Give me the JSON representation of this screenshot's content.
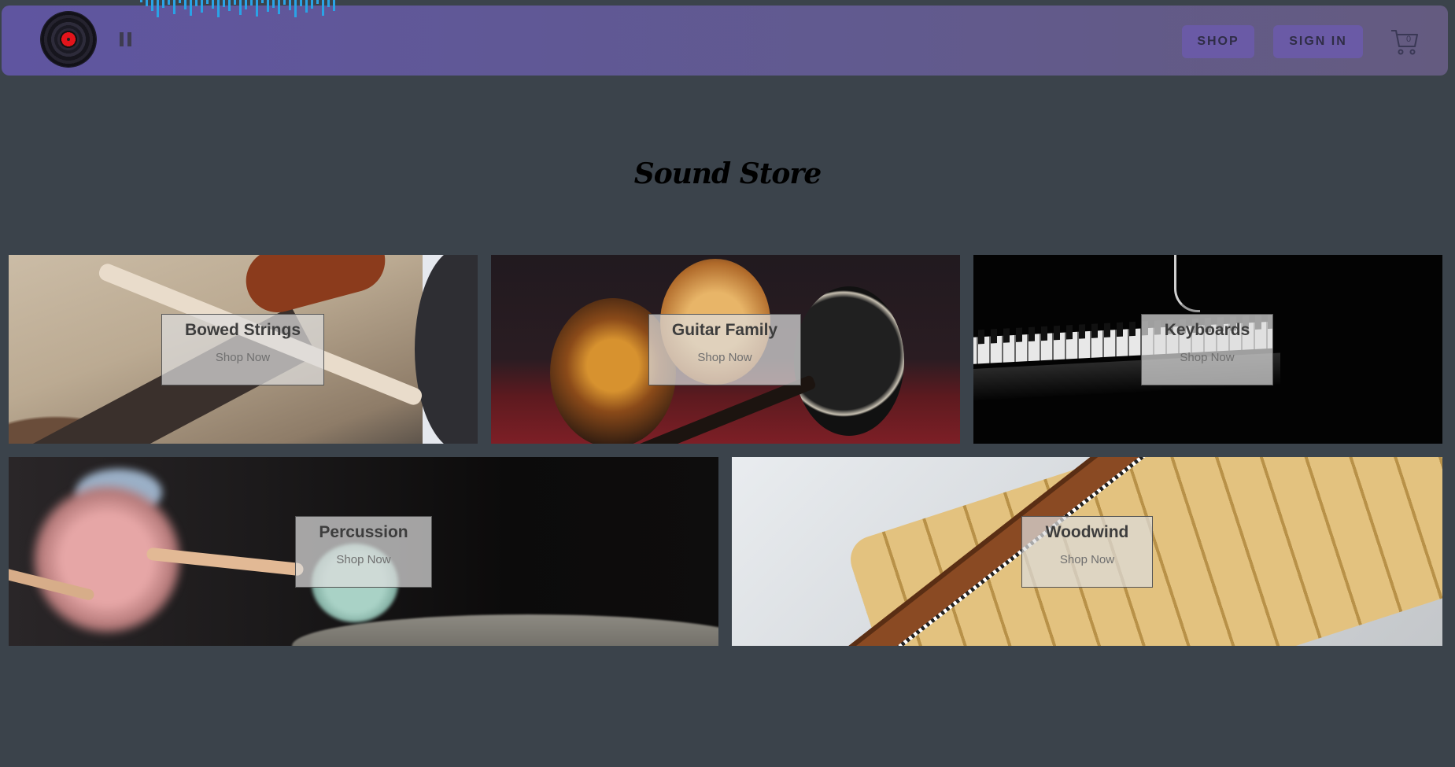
{
  "header": {
    "shop_label": "SHOP",
    "signin_label": "SIGN IN",
    "cart_count": "0"
  },
  "page": {
    "title": "Sound Store"
  },
  "categories": [
    {
      "name": "Bowed Strings",
      "cta": "Shop Now"
    },
    {
      "name": "Guitar Family",
      "cta": "Shop Now"
    },
    {
      "name": "Keyboards",
      "cta": "Shop Now"
    },
    {
      "name": "Percussion",
      "cta": "Shop Now"
    },
    {
      "name": "Woodwind",
      "cta": "Shop Now"
    }
  ],
  "colors": {
    "background": "#3b434b",
    "header": "#5f55a0",
    "button": "#6a5aa6",
    "waveform": "#2aa3e6",
    "vinyl_label": "#e3141b"
  }
}
